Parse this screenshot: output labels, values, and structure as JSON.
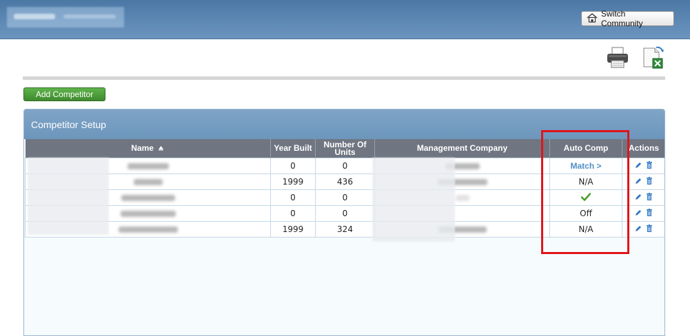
{
  "header": {
    "switch_community_label": "Switch Community",
    "icons": [
      "home-icon",
      "print-icon",
      "excel-export-icon"
    ]
  },
  "toolbar": {
    "add_competitor_label": "Add Competitor"
  },
  "panel": {
    "title": "Competitor Setup",
    "columns": [
      "Name",
      "Year Built",
      "Number Of Units",
      "Management Company",
      "Auto Comp",
      "Actions"
    ],
    "rows": [
      {
        "year_built": "0",
        "units": "0",
        "auto_comp": "Match >",
        "auto_comp_type": "link"
      },
      {
        "year_built": "1999",
        "units": "436",
        "auto_comp": "N/A",
        "auto_comp_type": "text"
      },
      {
        "year_built": "0",
        "units": "0",
        "auto_comp": "",
        "auto_comp_type": "check"
      },
      {
        "year_built": "0",
        "units": "0",
        "auto_comp": "Off",
        "auto_comp_type": "text"
      },
      {
        "year_built": "1999",
        "units": "324",
        "auto_comp": "N/A",
        "auto_comp_type": "text"
      }
    ]
  },
  "colors": {
    "header_bg": "#5f8ab6",
    "panel_head_bg": "#6d96bd",
    "table_head_bg": "#6f7681",
    "add_button_green": "#3f8a2f",
    "match_link": "#4f8fc6",
    "check_green": "#4a9d2a",
    "highlight_red": "#e0141a"
  }
}
